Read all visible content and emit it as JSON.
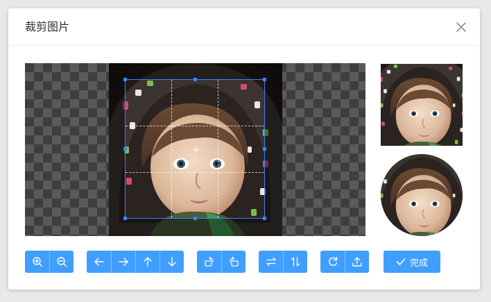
{
  "dialog": {
    "title": "裁剪图片",
    "close_icon": "close-icon"
  },
  "cropper": {
    "background": "checkerboard-transparent",
    "accent_color": "#3a86ff"
  },
  "toolbar": {
    "color": "#409eff",
    "groups": [
      {
        "name": "zoom",
        "icons": [
          "zoom-in-icon",
          "zoom-out-icon"
        ]
      },
      {
        "name": "move",
        "icons": [
          "arrow-left-icon",
          "arrow-right-icon",
          "arrow-up-icon",
          "arrow-down-icon"
        ]
      },
      {
        "name": "rotate",
        "icons": [
          "rotate-left-icon",
          "rotate-right-icon"
        ]
      },
      {
        "name": "flip",
        "icons": [
          "flip-horizontal-icon",
          "flip-vertical-icon"
        ]
      },
      {
        "name": "reset-upload",
        "icons": [
          "reset-icon",
          "upload-icon"
        ]
      }
    ],
    "done_label": "完成",
    "done_icon": "check-icon"
  }
}
